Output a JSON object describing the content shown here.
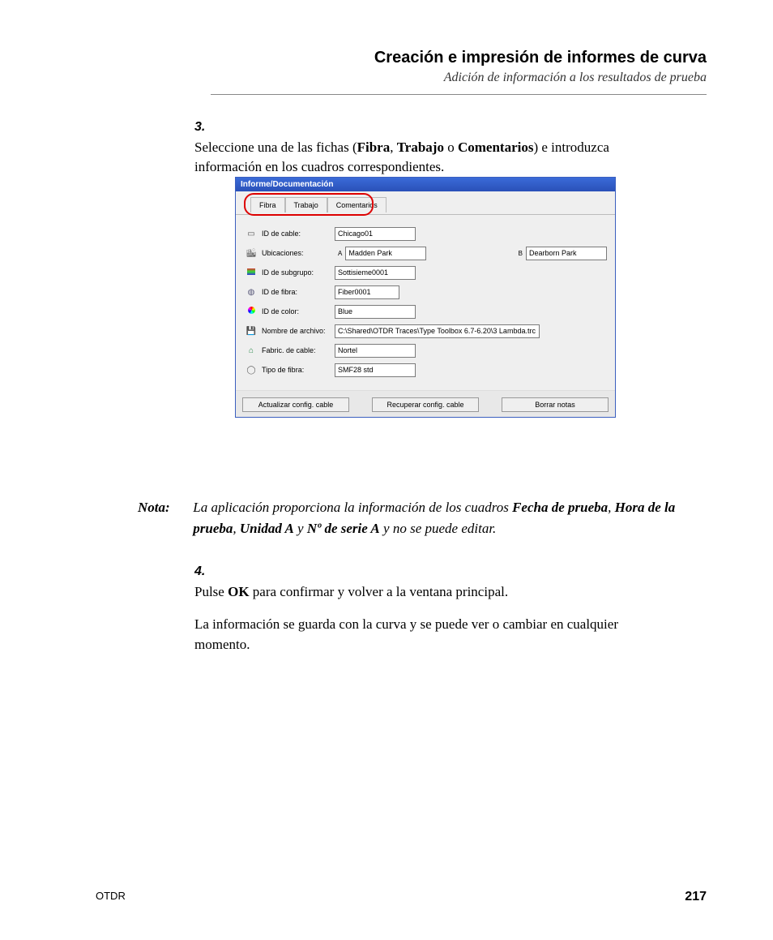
{
  "header": {
    "title": "Creación e impresión de informes de curva",
    "subtitle": "Adición de información a los resultados de prueba"
  },
  "step3": {
    "num": "3.",
    "pre": "Seleccione una de las fichas (",
    "t1": "Fibra",
    "sep1": ", ",
    "t2": "Trabajo",
    "sep2": " o ",
    "t3": "Comentarios",
    "post": ") e introduzca información en los cuadros correspondientes."
  },
  "shot": {
    "title": "Informe/Documentación",
    "tabs": {
      "fibra": "Fibra",
      "trabajo": "Trabajo",
      "comentarios": "Comentarios"
    },
    "rows": {
      "cable": {
        "label": "ID de cable:",
        "value": "Chicago01"
      },
      "loc": {
        "label": "Ubicaciones:",
        "labA": "A",
        "valA": "Madden Park",
        "labB": "B",
        "valB": "Dearborn Park"
      },
      "sub": {
        "label": "ID de subgrupo:",
        "value": "Sottisieme0001"
      },
      "fiber": {
        "label": "ID de fibra:",
        "value": "Fiber0001"
      },
      "color": {
        "label": "ID de color:",
        "value": "Blue"
      },
      "file": {
        "label": "Nombre de archivo:",
        "value": "C:\\Shared\\OTDR Traces\\Type Toolbox 6.7-6.20\\3 Lambda.trc"
      },
      "fab": {
        "label": "Fabric. de cable:",
        "value": "Nortel"
      },
      "type": {
        "label": "Tipo de fibra:",
        "value": "SMF28 std"
      }
    },
    "buttons": {
      "b1": "Actualizar config. cable",
      "b2": "Recuperar config. cable",
      "b3": "Borrar notas"
    }
  },
  "nota": {
    "label": "Nota:",
    "t1": "La aplicación proporciona la información de los cuadros ",
    "b1": "Fecha de prueba",
    "s1": ", ",
    "b2": "Hora de la prueba",
    "s2": ", ",
    "b3": "Unidad A",
    "s3": " y ",
    "b4": "Nº de serie A",
    "t2": " y no se puede editar."
  },
  "step4": {
    "num": "4.",
    "p1a": "Pulse ",
    "p1b": "OK",
    "p1c": " para confirmar y volver a la ventana principal.",
    "p2": "La información se guarda con la curva y se puede ver o cambiar en cualquier momento."
  },
  "footer": {
    "left": "OTDR",
    "right": "217"
  }
}
